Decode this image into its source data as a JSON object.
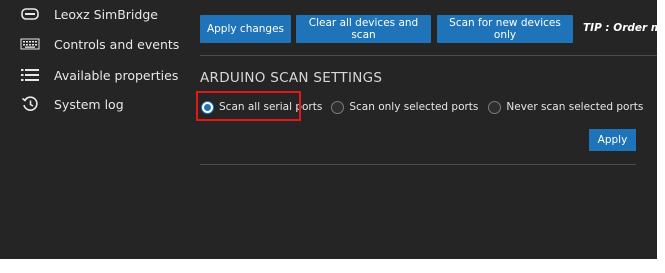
{
  "sidebar": {
    "items": [
      {
        "label": "Leoxz SimBridge",
        "icon": "gamepad-icon"
      },
      {
        "label": "Controls and events",
        "icon": "keyboard-icon"
      },
      {
        "label": "Available properties",
        "icon": "list-icon"
      },
      {
        "label": "System log",
        "icon": "history-icon"
      }
    ]
  },
  "toolbar": {
    "apply_changes_label": "Apply changes",
    "clear_label": "Clear all devices and scan",
    "scan_new_label": "Scan for new devices only",
    "tip_text": "TIP : Order matter"
  },
  "arduino": {
    "title": "ARDUINO SCAN SETTINGS",
    "options": [
      {
        "label": "Scan all serial ports",
        "selected": true
      },
      {
        "label": "Scan only selected ports",
        "selected": false
      },
      {
        "label": "Never scan selected ports",
        "selected": false
      }
    ],
    "apply_label": "Apply"
  },
  "colors": {
    "background": "#252525",
    "accent": "#1f74b9",
    "highlight": "#e11818"
  }
}
